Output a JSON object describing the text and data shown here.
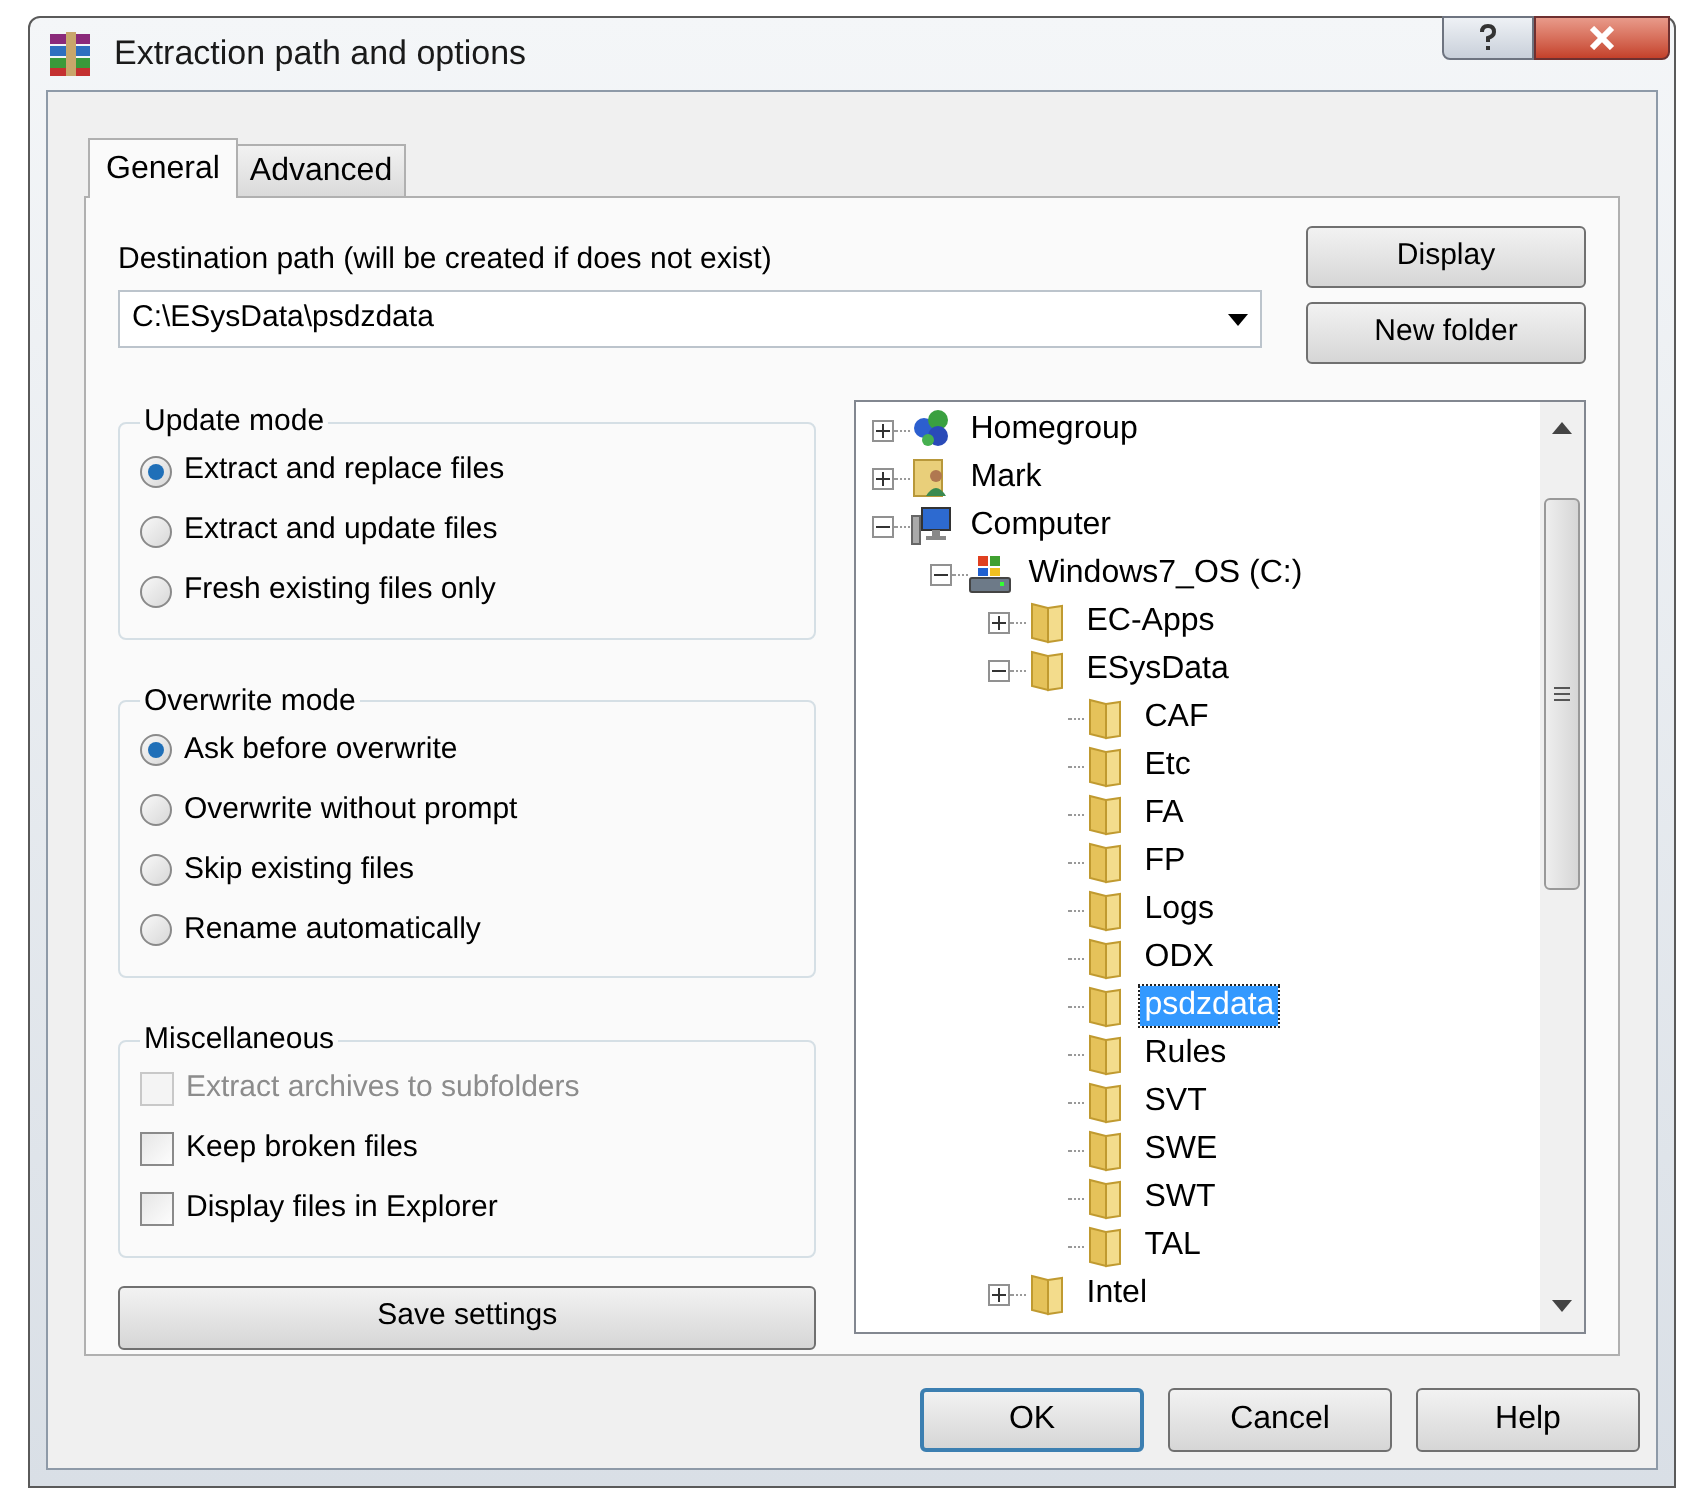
{
  "window": {
    "title": "Extraction path and options"
  },
  "tabs": [
    {
      "label": "General",
      "selected": true
    },
    {
      "label": "Advanced",
      "selected": false
    }
  ],
  "destination": {
    "label": "Destination path (will be created if does not exist)",
    "value": "C:\\ESysData\\psdzdata"
  },
  "side_buttons": [
    "Display",
    "New folder"
  ],
  "groups": [
    {
      "title": "Update mode",
      "kind": "radio",
      "options": [
        {
          "label": "Extract and replace files",
          "selected": true
        },
        {
          "label": "Extract and update files",
          "selected": false
        },
        {
          "label": "Fresh existing files only",
          "selected": false
        }
      ]
    },
    {
      "title": "Overwrite mode",
      "kind": "radio",
      "options": [
        {
          "label": "Ask before overwrite",
          "selected": true
        },
        {
          "label": "Overwrite without prompt",
          "selected": false
        },
        {
          "label": "Skip existing files",
          "selected": false
        },
        {
          "label": "Rename automatically",
          "selected": false
        }
      ]
    },
    {
      "title": "Miscellaneous",
      "kind": "checkbox",
      "options": [
        {
          "label": "Extract archives to subfolders",
          "checked": false,
          "disabled": true
        },
        {
          "label": "Keep broken files",
          "checked": false,
          "disabled": false
        },
        {
          "label": "Display files in Explorer",
          "checked": false,
          "disabled": false
        }
      ]
    }
  ],
  "save_button": "Save settings",
  "tree": [
    {
      "label": "Homegroup",
      "kind": "network",
      "expanded": false,
      "selected": false
    },
    {
      "label": "Mark",
      "kind": "user",
      "expanded": false,
      "selected": false
    },
    {
      "label": "Computer",
      "kind": "computer",
      "expanded": true,
      "selected": false,
      "children": [
        {
          "label": "Windows7_OS (C:)",
          "kind": "drive",
          "expanded": true,
          "selected": false,
          "children": [
            {
              "label": "EC-Apps",
              "kind": "folder",
              "expanded": false,
              "selected": false
            },
            {
              "label": "ESysData",
              "kind": "folder",
              "expanded": true,
              "selected": false,
              "children": [
                {
                  "label": "CAF",
                  "kind": "folder",
                  "selected": false
                },
                {
                  "label": "Etc",
                  "kind": "folder",
                  "selected": false
                },
                {
                  "label": "FA",
                  "kind": "folder",
                  "selected": false
                },
                {
                  "label": "FP",
                  "kind": "folder",
                  "selected": false
                },
                {
                  "label": "Logs",
                  "kind": "folder",
                  "selected": false
                },
                {
                  "label": "ODX",
                  "kind": "folder",
                  "selected": false
                },
                {
                  "label": "psdzdata",
                  "kind": "folder",
                  "selected": true
                },
                {
                  "label": "Rules",
                  "kind": "folder",
                  "selected": false
                },
                {
                  "label": "SVT",
                  "kind": "folder",
                  "selected": false
                },
                {
                  "label": "SWE",
                  "kind": "folder",
                  "selected": false
                },
                {
                  "label": "SWT",
                  "kind": "folder",
                  "selected": false
                },
                {
                  "label": "TAL",
                  "kind": "folder",
                  "selected": false
                }
              ]
            },
            {
              "label": "Intel",
              "kind": "folder",
              "expanded": false,
              "selected": false
            }
          ]
        }
      ]
    }
  ],
  "dialog_buttons": [
    {
      "label": "OK",
      "default": true
    },
    {
      "label": "Cancel",
      "default": false
    },
    {
      "label": "Help",
      "default": false
    }
  ]
}
